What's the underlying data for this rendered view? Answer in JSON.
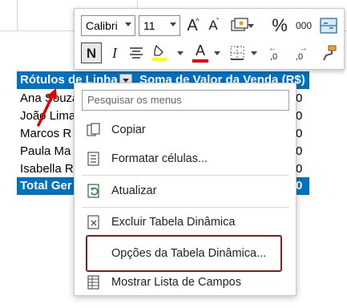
{
  "pivot": {
    "header_row_labels": "Rótulos de Linha",
    "header_sum": "Soma de Valor da Venda (R$)",
    "rows": [
      {
        "name": "Ana Souza",
        "value": "0"
      },
      {
        "name": "João Lima",
        "value": "0"
      },
      {
        "name": "Marcos R",
        "value": "0"
      },
      {
        "name": "Paula Ma",
        "value": "0"
      },
      {
        "name": "Isabella R",
        "value": "0"
      }
    ],
    "total_label": "Total Ger",
    "total_value": "0"
  },
  "mini_toolbar": {
    "font_name": "Calibri",
    "font_size": "11",
    "bold_label": "N",
    "italic_label": "I",
    "percent_label": "%",
    "thousands_label": "000",
    "grow_font_label": "A",
    "shrink_font_label": "A",
    "font_color_label": "A",
    "decimal_inc_label": ",0",
    "decimal_dec_label": ",0",
    "highlight_color": "#ffff00",
    "font_color": "#e00000"
  },
  "context_menu": {
    "search_placeholder": "Pesquisar os menus",
    "items": [
      {
        "label": "Copiar",
        "icon": "copy-icon"
      },
      {
        "label": "Formatar células...",
        "icon": "format-cells-icon"
      },
      {
        "label": "Atualizar",
        "icon": "refresh-icon"
      },
      {
        "label": "Excluir Tabela Dinâmica",
        "icon": "delete-pivot-icon"
      },
      {
        "label": "Opções da Tabela Dinâmica...",
        "icon": ""
      },
      {
        "label": "Mostrar Lista de Campos",
        "icon": "field-list-icon"
      }
    ]
  },
  "colors": {
    "pivot_header": "#0070c0",
    "highlight_box": "#8b1a1a",
    "arrow": "#e00000"
  }
}
